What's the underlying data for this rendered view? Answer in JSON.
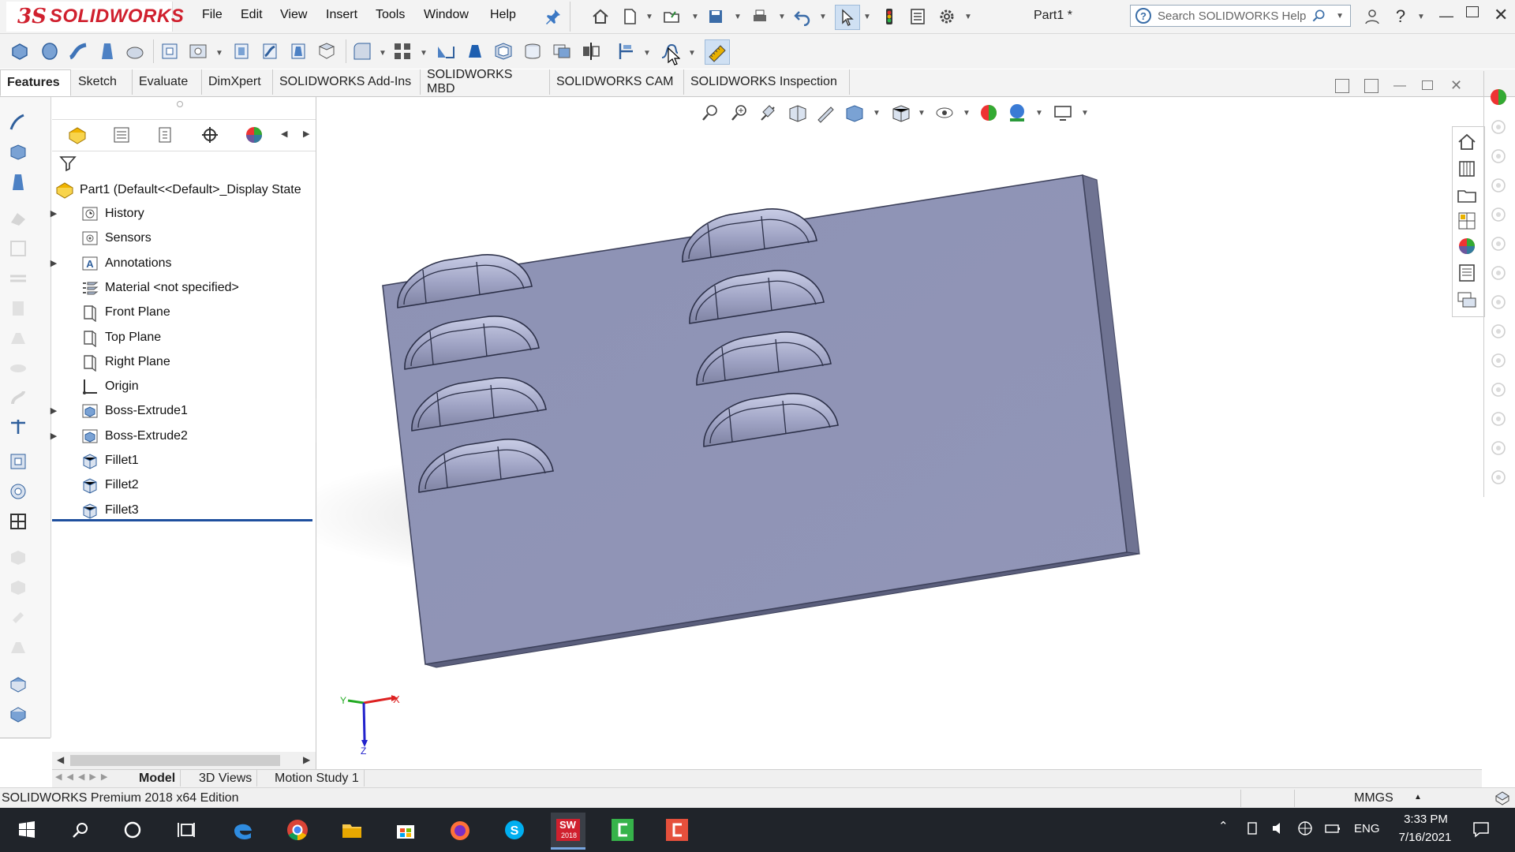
{
  "app": {
    "brand": "SOLIDWORKS",
    "document_title": "Part1 *"
  },
  "menu": [
    "File",
    "Edit",
    "View",
    "Insert",
    "Tools",
    "Window",
    "Help"
  ],
  "search": {
    "placeholder": "Search SOLIDWORKS Help"
  },
  "tabs": [
    "Features",
    "Sketch",
    "Evaluate",
    "DimXpert",
    "SOLIDWORKS Add-Ins",
    "SOLIDWORKS MBD",
    "SOLIDWORKS CAM",
    "SOLIDWORKS Inspection"
  ],
  "active_tab": "Features",
  "feature_tree": {
    "root": "Part1  (Default<<Default>_Display State",
    "items": [
      {
        "label": "History",
        "expandable": true,
        "icon": "history-icon"
      },
      {
        "label": "Sensors",
        "expandable": false,
        "icon": "sensors-icon"
      },
      {
        "label": "Annotations",
        "expandable": true,
        "icon": "annotations-icon"
      },
      {
        "label": "Material <not specified>",
        "expandable": false,
        "icon": "material-icon"
      },
      {
        "label": "Front Plane",
        "expandable": false,
        "icon": "plane-icon"
      },
      {
        "label": "Top Plane",
        "expandable": false,
        "icon": "plane-icon"
      },
      {
        "label": "Right Plane",
        "expandable": false,
        "icon": "plane-icon"
      },
      {
        "label": "Origin",
        "expandable": false,
        "icon": "origin-icon"
      },
      {
        "label": "Boss-Extrude1",
        "expandable": true,
        "icon": "extrude-icon"
      },
      {
        "label": "Boss-Extrude2",
        "expandable": true,
        "icon": "extrude-icon"
      },
      {
        "label": "Fillet1",
        "expandable": false,
        "icon": "fillet-icon"
      },
      {
        "label": "Fillet2",
        "expandable": false,
        "icon": "fillet-icon"
      },
      {
        "label": "Fillet3",
        "expandable": false,
        "icon": "fillet-icon"
      }
    ]
  },
  "bottom_tabs": [
    "Model",
    "3D Views",
    "Motion Study 1"
  ],
  "active_bottom_tab": "Model",
  "status": {
    "edition": "SOLIDWORKS Premium 2018 x64 Edition",
    "units": "MMGS"
  },
  "triad": {
    "x": "X",
    "y": "Y",
    "z": "Z"
  },
  "taskbar": {
    "language": "ENG",
    "time": "3:33 PM",
    "date": "7/16/2021",
    "sw_badge": "2018"
  },
  "colors": {
    "brand_red": "#d0202e",
    "part_face": "#8f94b6",
    "part_edge": "#5c6080",
    "taskbar": "#20242a"
  }
}
